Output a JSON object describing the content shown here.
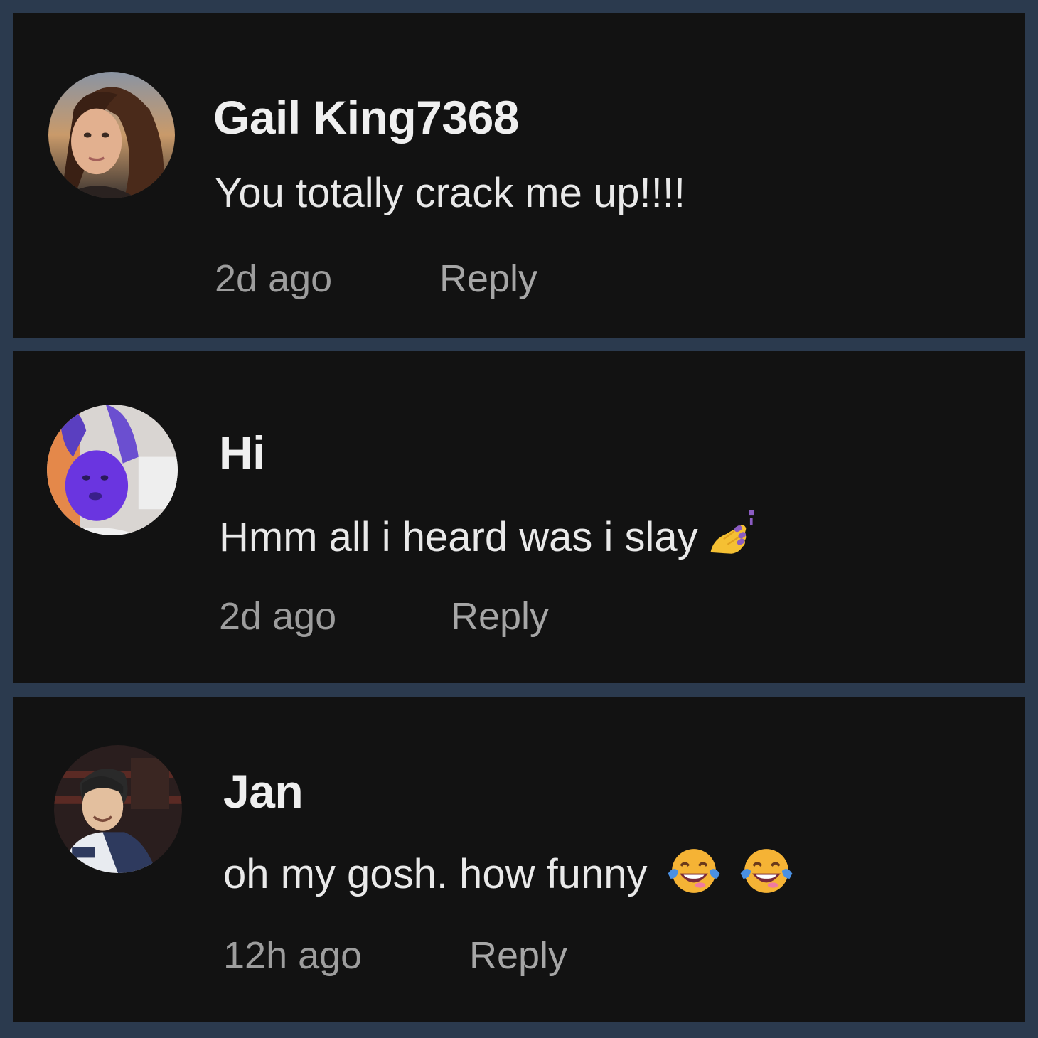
{
  "comments": [
    {
      "username": "Gail King7368",
      "text": "You totally crack me up!!!!",
      "time": "2d ago",
      "reply_label": "Reply",
      "avatar_icon": "woman-portrait-avatar"
    },
    {
      "username": "Hi",
      "text": "Hmm all i heard was i slay",
      "emoji": [
        "nail-polish-emoji"
      ],
      "time": "2d ago",
      "reply_label": "Reply",
      "avatar_icon": "purple-doll-avatar"
    },
    {
      "username": "Jan",
      "text": "oh my gosh. how funny",
      "emoji": [
        "tears-of-joy-emoji",
        "tears-of-joy-emoji"
      ],
      "time": "12h ago",
      "reply_label": "Reply",
      "avatar_icon": "smiling-person-avatar"
    }
  ],
  "colors": {
    "background": "#2b3a4e",
    "card": "#121212",
    "text_primary": "#efefef",
    "text_secondary": "#9d9d9d"
  }
}
